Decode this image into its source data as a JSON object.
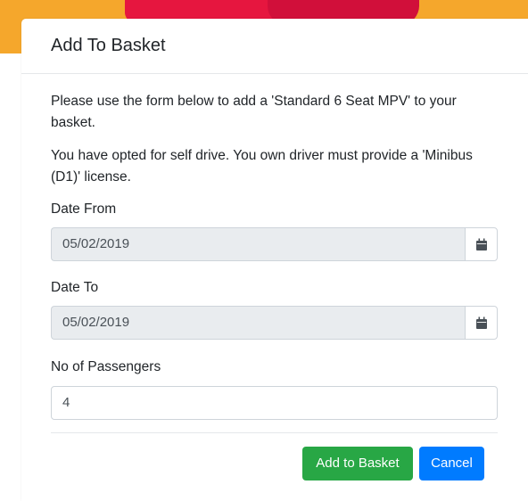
{
  "modal": {
    "title": "Add To Basket",
    "intro": "Please use the form below to add a 'Standard 6 Seat MPV' to your basket.",
    "notice": "You have opted for self drive. You own driver must provide a 'Minibus (D1)' license.",
    "date_from": {
      "label": "Date From",
      "value": "05/02/2019",
      "icon": "calendar-icon"
    },
    "date_to": {
      "label": "Date To",
      "value": "05/02/2019",
      "icon": "calendar-icon"
    },
    "passengers": {
      "label": "No of Passengers",
      "value": "4"
    },
    "buttons": {
      "add": "Add to Basket",
      "cancel": "Cancel"
    }
  },
  "colors": {
    "backdrop_orange": "#f5a72c",
    "backdrop_red": "#e6163f",
    "add_button": "#28a745",
    "cancel_button": "#007bff",
    "readonly_input_bg": "#e9ecef"
  }
}
